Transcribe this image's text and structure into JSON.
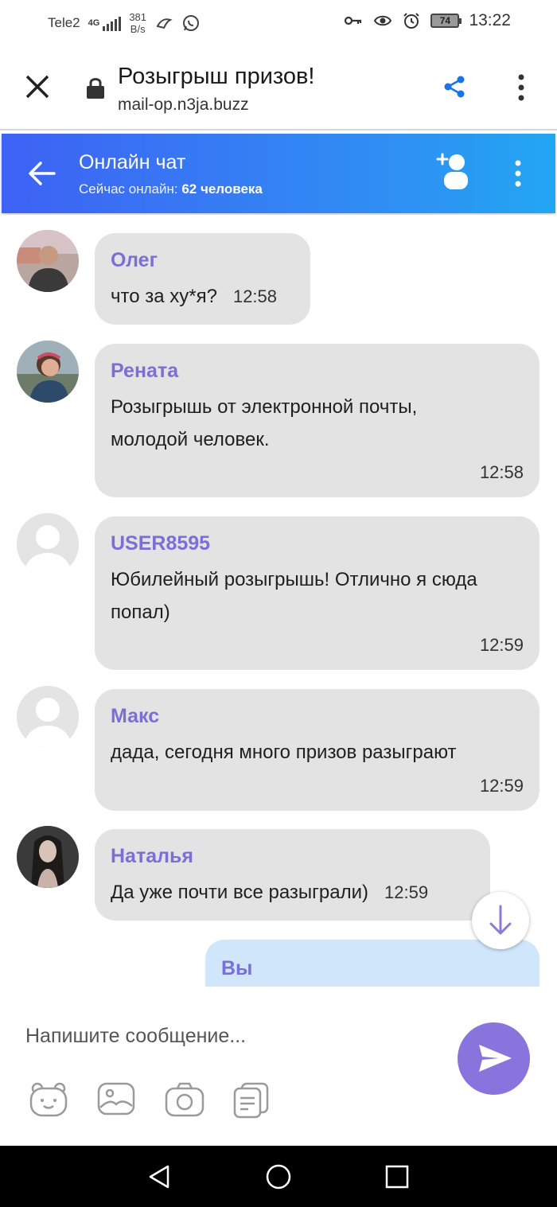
{
  "status_bar": {
    "carrier": "Tele2",
    "network": "4G",
    "speed_value": "381",
    "speed_unit": "B/s",
    "battery": "74",
    "time": "13:22"
  },
  "browser": {
    "page_title": "Розыгрыш призов!",
    "url": "mail-op.n3ja.buzz",
    "icons": [
      "close-icon",
      "lock-icon",
      "share-icon",
      "more-vertical-icon"
    ]
  },
  "chat_header": {
    "title": "Онлайн чат",
    "online_label": "Сейчас онлайн:",
    "online_count": "62 человека",
    "icons": [
      "back-arrow-icon",
      "add-user-icon",
      "more-vertical-icon"
    ]
  },
  "messages": [
    {
      "name": "Олег",
      "text": "что за ху*я?",
      "time": "12:58",
      "avatar": "photo-man"
    },
    {
      "name": "Рената",
      "text": "Розыгрышь от электронной почты, молодой человек.",
      "time": "12:58",
      "avatar": "photo-woman"
    },
    {
      "name": "USER8595",
      "text": "Юбилейный розыгрышь! Отлично я сюда попал)",
      "time": "12:59",
      "avatar": "default-avatar"
    },
    {
      "name": "Макс",
      "text": "дада, сегодня много призов разыграют",
      "time": "12:59",
      "avatar": "default-avatar"
    },
    {
      "name": "Наталья",
      "text": "Да уже почти все разыграли)",
      "time": "12:59",
      "avatar": "photo-woman-dark"
    }
  ],
  "my_message": {
    "name": "Вы"
  },
  "composer": {
    "placeholder": "Напишите сообщение...",
    "tools": [
      "sticker-icon",
      "image-icon",
      "camera-icon",
      "files-icon"
    ],
    "send_icon": "send-icon"
  },
  "colors": {
    "header_gradient_start": "#3e62f5",
    "header_gradient_end": "#22a6f2",
    "accent_purple": "#7a6fd6",
    "send_button": "#8874dc",
    "bubble_grey": "#e3e3e3",
    "my_bubble": "#cfe6fb"
  }
}
